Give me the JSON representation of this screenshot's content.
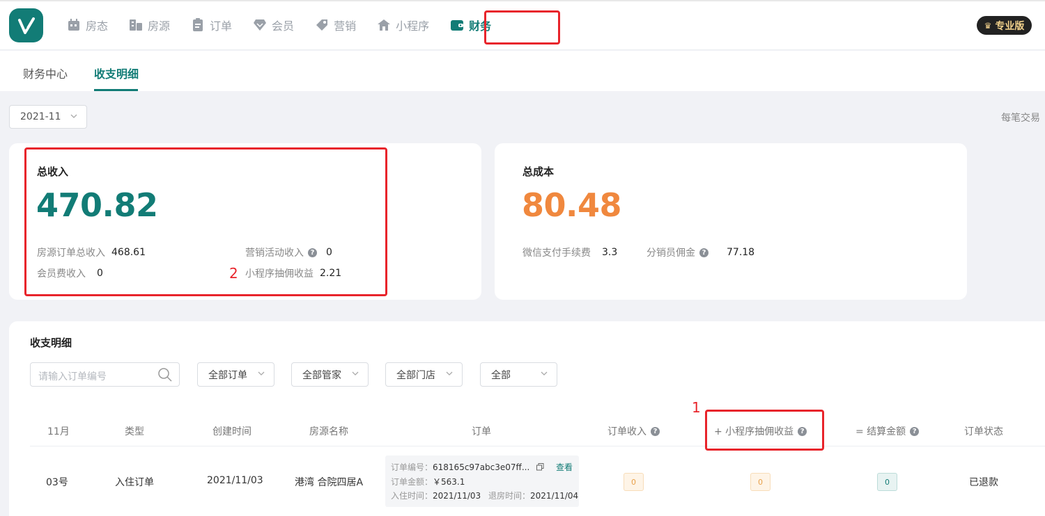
{
  "nav": {
    "items": [
      {
        "label": "房态",
        "icon": "calendar-icon"
      },
      {
        "label": "房源",
        "icon": "building-icon"
      },
      {
        "label": "订单",
        "icon": "clipboard-icon"
      },
      {
        "label": "会员",
        "icon": "diamond-icon"
      },
      {
        "label": "营销",
        "icon": "tag-icon"
      },
      {
        "label": "小程序",
        "icon": "home-icon"
      },
      {
        "label": "财务",
        "icon": "wallet-icon"
      }
    ],
    "active_label": "财务",
    "pro_badge": "专业版"
  },
  "subnav": {
    "tabs": [
      "财务中心",
      "收支明细"
    ],
    "active": "收支明细"
  },
  "filter": {
    "month": "2021-11",
    "note": "每笔交易"
  },
  "income": {
    "title": "总收入",
    "total": "470.82",
    "items": [
      {
        "label": "房源订单总收入",
        "value": "468.61"
      },
      {
        "label": "营销活动收入",
        "value": "0"
      },
      {
        "label": "会员费收入",
        "value": "0"
      },
      {
        "label": "小程序抽佣收益",
        "value": "2.21"
      }
    ],
    "annotation": "2"
  },
  "cost": {
    "title": "总成本",
    "total": "80.48",
    "items": [
      {
        "label": "微信支付手续费",
        "value": "3.3"
      },
      {
        "label": "分销员佣金",
        "value": "77.18"
      }
    ]
  },
  "detail": {
    "title": "收支明细",
    "search_placeholder": "请输入订单编号",
    "dropdowns": [
      "全部订单",
      "全部管家",
      "全部门店",
      "全部"
    ],
    "annotation": "1",
    "columns": [
      "11月",
      "类型",
      "创建时间",
      "房源名称",
      "订单",
      "订单收入",
      "+ 小程序抽佣收益",
      "= 结算金额",
      "订单状态"
    ],
    "rows": [
      {
        "day": "03号",
        "type": "入住订单",
        "created": "2021/11/03",
        "room": "港湾 合院四居A",
        "order_no_label": "订单编号：",
        "order_no": "618165c97abc3e07ff...",
        "view": "查看",
        "amount_label": "订单金额：",
        "amount": "￥563.1",
        "checkin_label": "入住时间：",
        "checkin": "2021/11/03",
        "checkout_label": "退房时间：",
        "checkout": "2021/11/04",
        "order_income": "0",
        "commission": "0",
        "settlement": "0",
        "status": "已退款"
      }
    ]
  },
  "colors": {
    "brand": "#127c76",
    "cost": "#f0883e",
    "annotation": "#e8242b"
  }
}
